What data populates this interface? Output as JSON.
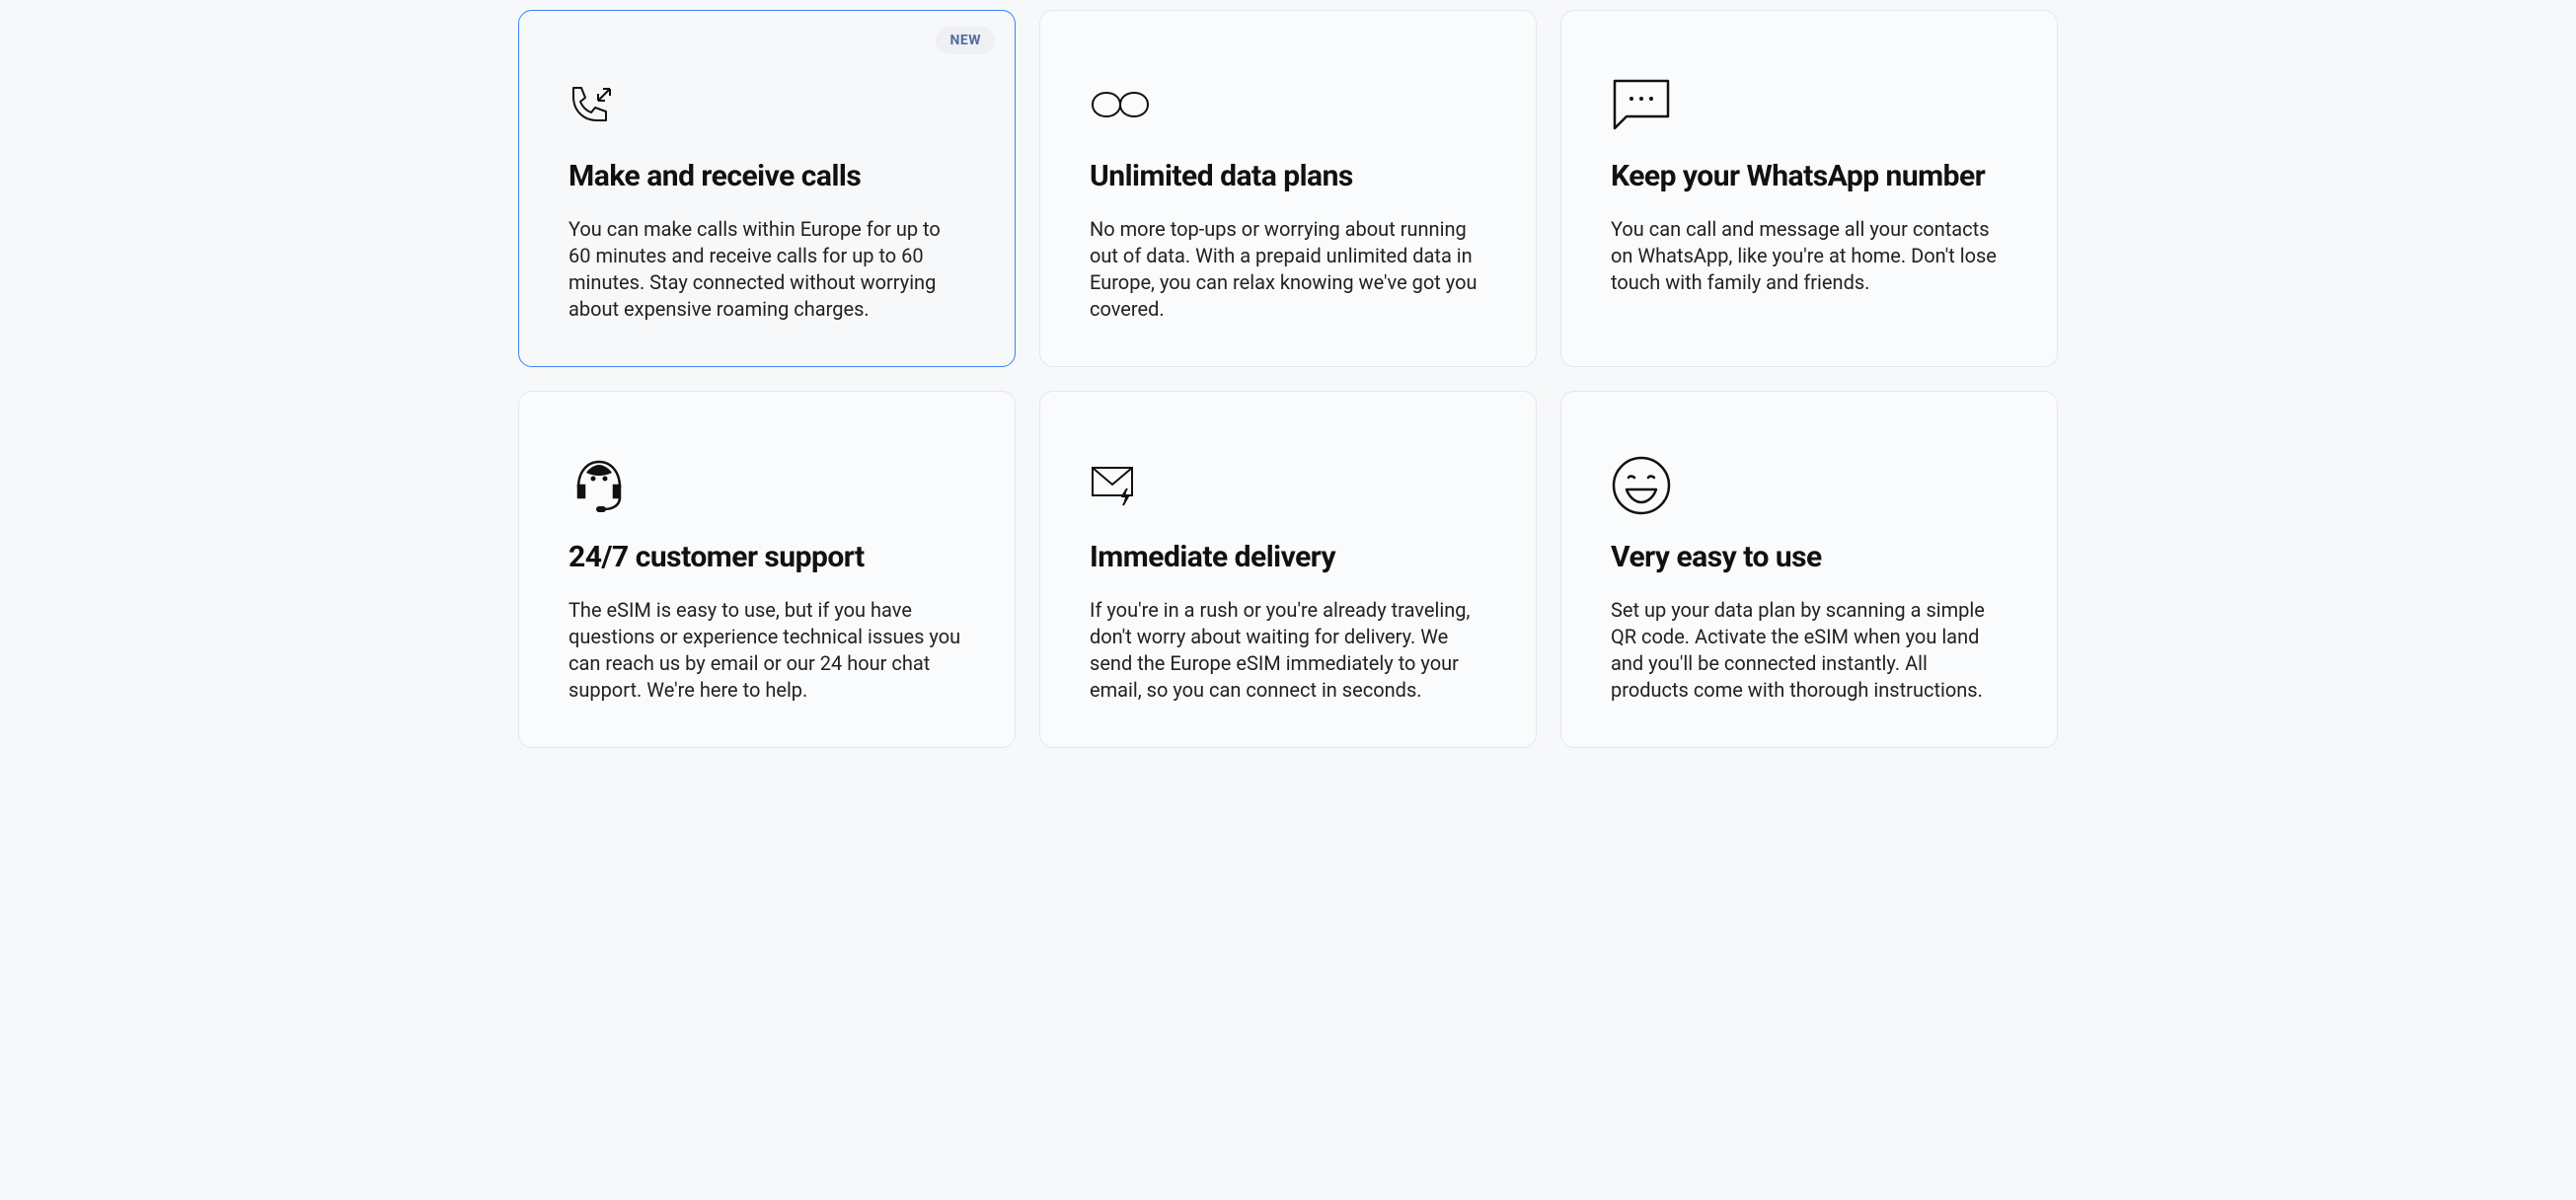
{
  "features": [
    {
      "badge": "NEW",
      "title": "Make and receive calls",
      "desc": "You can make calls within Europe for up to 60 minutes and receive calls for up to 60 minutes. Stay connected without worrying about expensive roaming charges."
    },
    {
      "title": "Unlimited data plans",
      "desc": "No more top-ups or worrying about running out of data. With a prepaid unlimited data in Europe, you can relax knowing we've got you covered."
    },
    {
      "title": "Keep your WhatsApp number",
      "desc": "You can call and message all your contacts on WhatsApp, like you're at home. Don't lose touch with family and friends."
    },
    {
      "title": "24/7 customer support",
      "desc": "The eSIM is easy to use, but if you have questions or experience technical issues you can reach us by email or our 24 hour chat support. We're here to help."
    },
    {
      "title": "Immediate delivery",
      "desc": "If you're in a rush or you're already traveling, don't worry about waiting for delivery. We send the Europe eSIM immediately to your email, so you can connect in seconds."
    },
    {
      "title": "Very easy to use",
      "desc": "Set up your data plan by scanning a simple QR code. Activate the eSIM when you land and you'll be connected instantly. All products come with thorough instructions."
    }
  ]
}
